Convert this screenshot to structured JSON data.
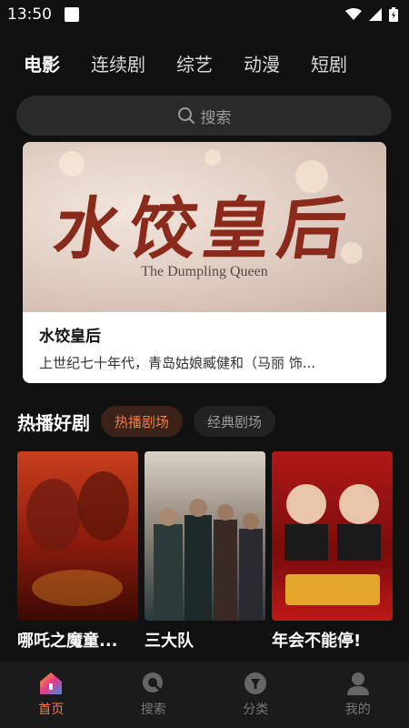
{
  "status_bar": {
    "time": "13:50"
  },
  "category_tabs": [
    {
      "label": "电影",
      "active": true
    },
    {
      "label": "连续剧",
      "active": false
    },
    {
      "label": "综艺",
      "active": false
    },
    {
      "label": "动漫",
      "active": false
    },
    {
      "label": "短剧",
      "active": false
    }
  ],
  "search": {
    "placeholder": "搜索"
  },
  "banner": {
    "calligraphy": "水饺皇后",
    "subtitle": "The Dumpling Queen",
    "title": "水饺皇后",
    "description": "上世纪七十年代，青岛姑娘臧健和（马丽 饰..."
  },
  "section": {
    "title": "热播好剧",
    "chips": [
      {
        "label": "热播剧场",
        "active": true
      },
      {
        "label": "经典剧场",
        "active": false
      }
    ]
  },
  "posters": [
    {
      "title": "哪吒之魔童..."
    },
    {
      "title": "三大队"
    },
    {
      "title": "年会不能停!"
    }
  ],
  "bottom_nav": [
    {
      "label": "首页",
      "icon": "home-icon",
      "active": true
    },
    {
      "label": "搜索",
      "icon": "search-icon",
      "active": false
    },
    {
      "label": "分类",
      "icon": "category-icon",
      "active": false
    },
    {
      "label": "我的",
      "icon": "user-icon",
      "active": false
    }
  ],
  "colors": {
    "accent": "#f07c4a",
    "background": "#111111"
  }
}
